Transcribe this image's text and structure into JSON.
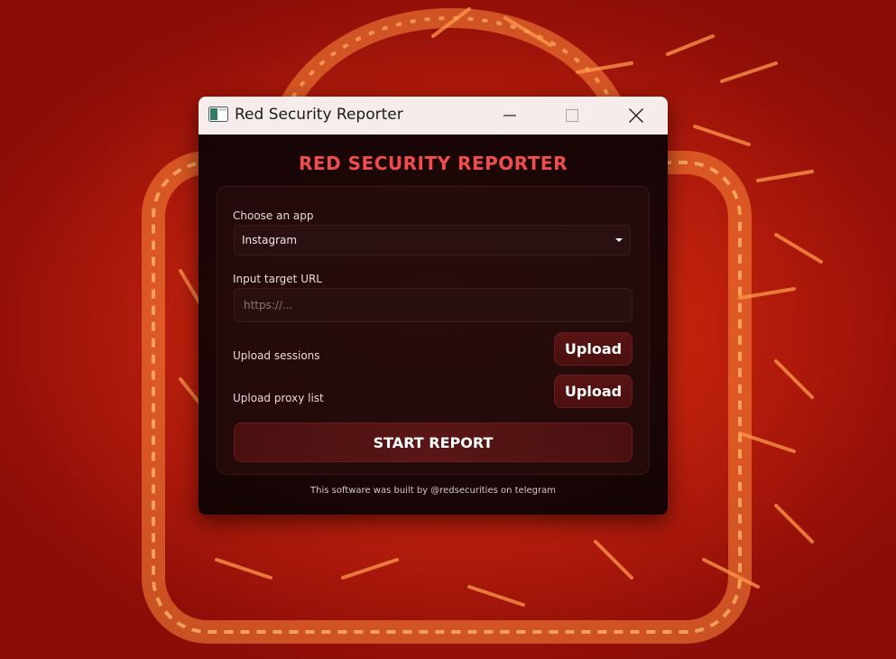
{
  "window": {
    "title": "Red Security Reporter",
    "icon": "app-window-icon",
    "controls": {
      "minimize_icon": "minimize-icon",
      "maximize_icon": "maximize-icon",
      "close_icon": "close-icon"
    }
  },
  "header": {
    "title": "RED SECURITY REPORTER",
    "title_color": "#ef4d4d"
  },
  "form": {
    "app_label": "Choose an app",
    "app_selected": "Instagram",
    "url_label": "Input target URL",
    "url_placeholder": "https://...",
    "url_value": "",
    "sessions_label": "Upload sessions",
    "sessions_button": "Upload",
    "proxy_label": "Upload proxy list",
    "proxy_button": "Upload",
    "start_button": "START REPORT"
  },
  "footer": {
    "text": "This software was built by @redsecurities on telegram"
  },
  "colors": {
    "accent": "#ef4d4d",
    "button_bg": "#5a1414",
    "panel_bg": "#1a0707",
    "titlebar_bg": "#f7ecec"
  }
}
